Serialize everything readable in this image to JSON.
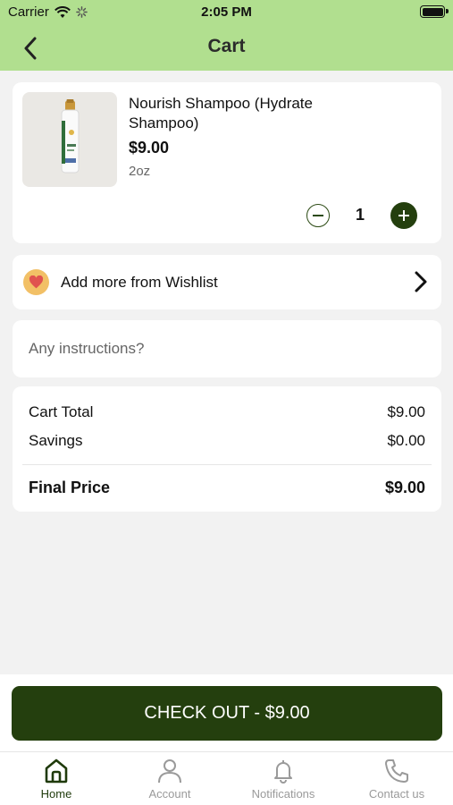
{
  "status_bar": {
    "carrier": "Carrier",
    "time": "2:05 PM"
  },
  "header": {
    "title": "Cart",
    "back_icon": "chevron-left-icon"
  },
  "cart_item": {
    "name": "Nourish Shampoo (Hydrate Shampoo)",
    "price": "$9.00",
    "size": "2oz",
    "quantity": "1"
  },
  "wishlist": {
    "label": "Add more from Wishlist",
    "icon": "heart-icon"
  },
  "instructions": {
    "placeholder": "Any instructions?"
  },
  "summary": {
    "cart_total_label": "Cart Total",
    "cart_total_value": "$9.00",
    "savings_label": "Savings",
    "savings_value": "$0.00",
    "final_price_label": "Final Price",
    "final_price_value": "$9.00"
  },
  "checkout": {
    "label": "CHECK OUT - $9.00"
  },
  "tabs": [
    {
      "label": "Home",
      "icon": "home-icon",
      "active": true
    },
    {
      "label": "Account",
      "icon": "user-icon",
      "active": false
    },
    {
      "label": "Notifications",
      "icon": "bell-icon",
      "active": false
    },
    {
      "label": "Contact us",
      "icon": "phone-icon",
      "active": false
    }
  ],
  "colors": {
    "header_bg": "#b1df8f",
    "primary": "#243f0e",
    "page_bg": "#f2f2f2"
  }
}
